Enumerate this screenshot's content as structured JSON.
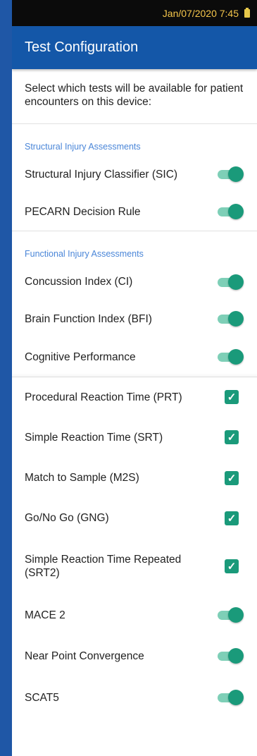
{
  "status_bar": {
    "datetime": "Jan/07/2020 7:45"
  },
  "app_bar": {
    "title": "Test Configuration"
  },
  "intro": {
    "text": "Select which tests will be available for patient encounters on this device:"
  },
  "structural": {
    "header": "Structural Injury Assessments",
    "items": [
      {
        "label": "Structural Injury Classifier (SIC)",
        "enabled": true
      },
      {
        "label": "PECARN Decision Rule",
        "enabled": true
      }
    ]
  },
  "functional": {
    "header": "Functional Injury Assessments",
    "items": [
      {
        "label": "Concussion Index (CI)",
        "enabled": true
      },
      {
        "label": "Brain Function Index (BFI)",
        "enabled": true
      },
      {
        "label": "Cognitive Performance",
        "enabled": true
      }
    ]
  },
  "cognitive_tests": [
    {
      "label": "Procedural Reaction Time (PRT)",
      "checked": true
    },
    {
      "label": "Simple Reaction Time (SRT)",
      "checked": true
    },
    {
      "label": "Match to Sample (M2S)",
      "checked": true
    },
    {
      "label": "Go/No Go (GNG)",
      "checked": true
    },
    {
      "label": "Simple Reaction Time Repeated (SRT2)",
      "checked": true
    }
  ],
  "other_tests": [
    {
      "label": "MACE 2",
      "enabled": true
    },
    {
      "label": "Near Point Convergence",
      "enabled": true
    },
    {
      "label": "SCAT5",
      "enabled": true
    }
  ],
  "colors": {
    "app_bar": "#1457a8",
    "accent": "#1a9a7a",
    "section_header": "#4a86d8"
  }
}
